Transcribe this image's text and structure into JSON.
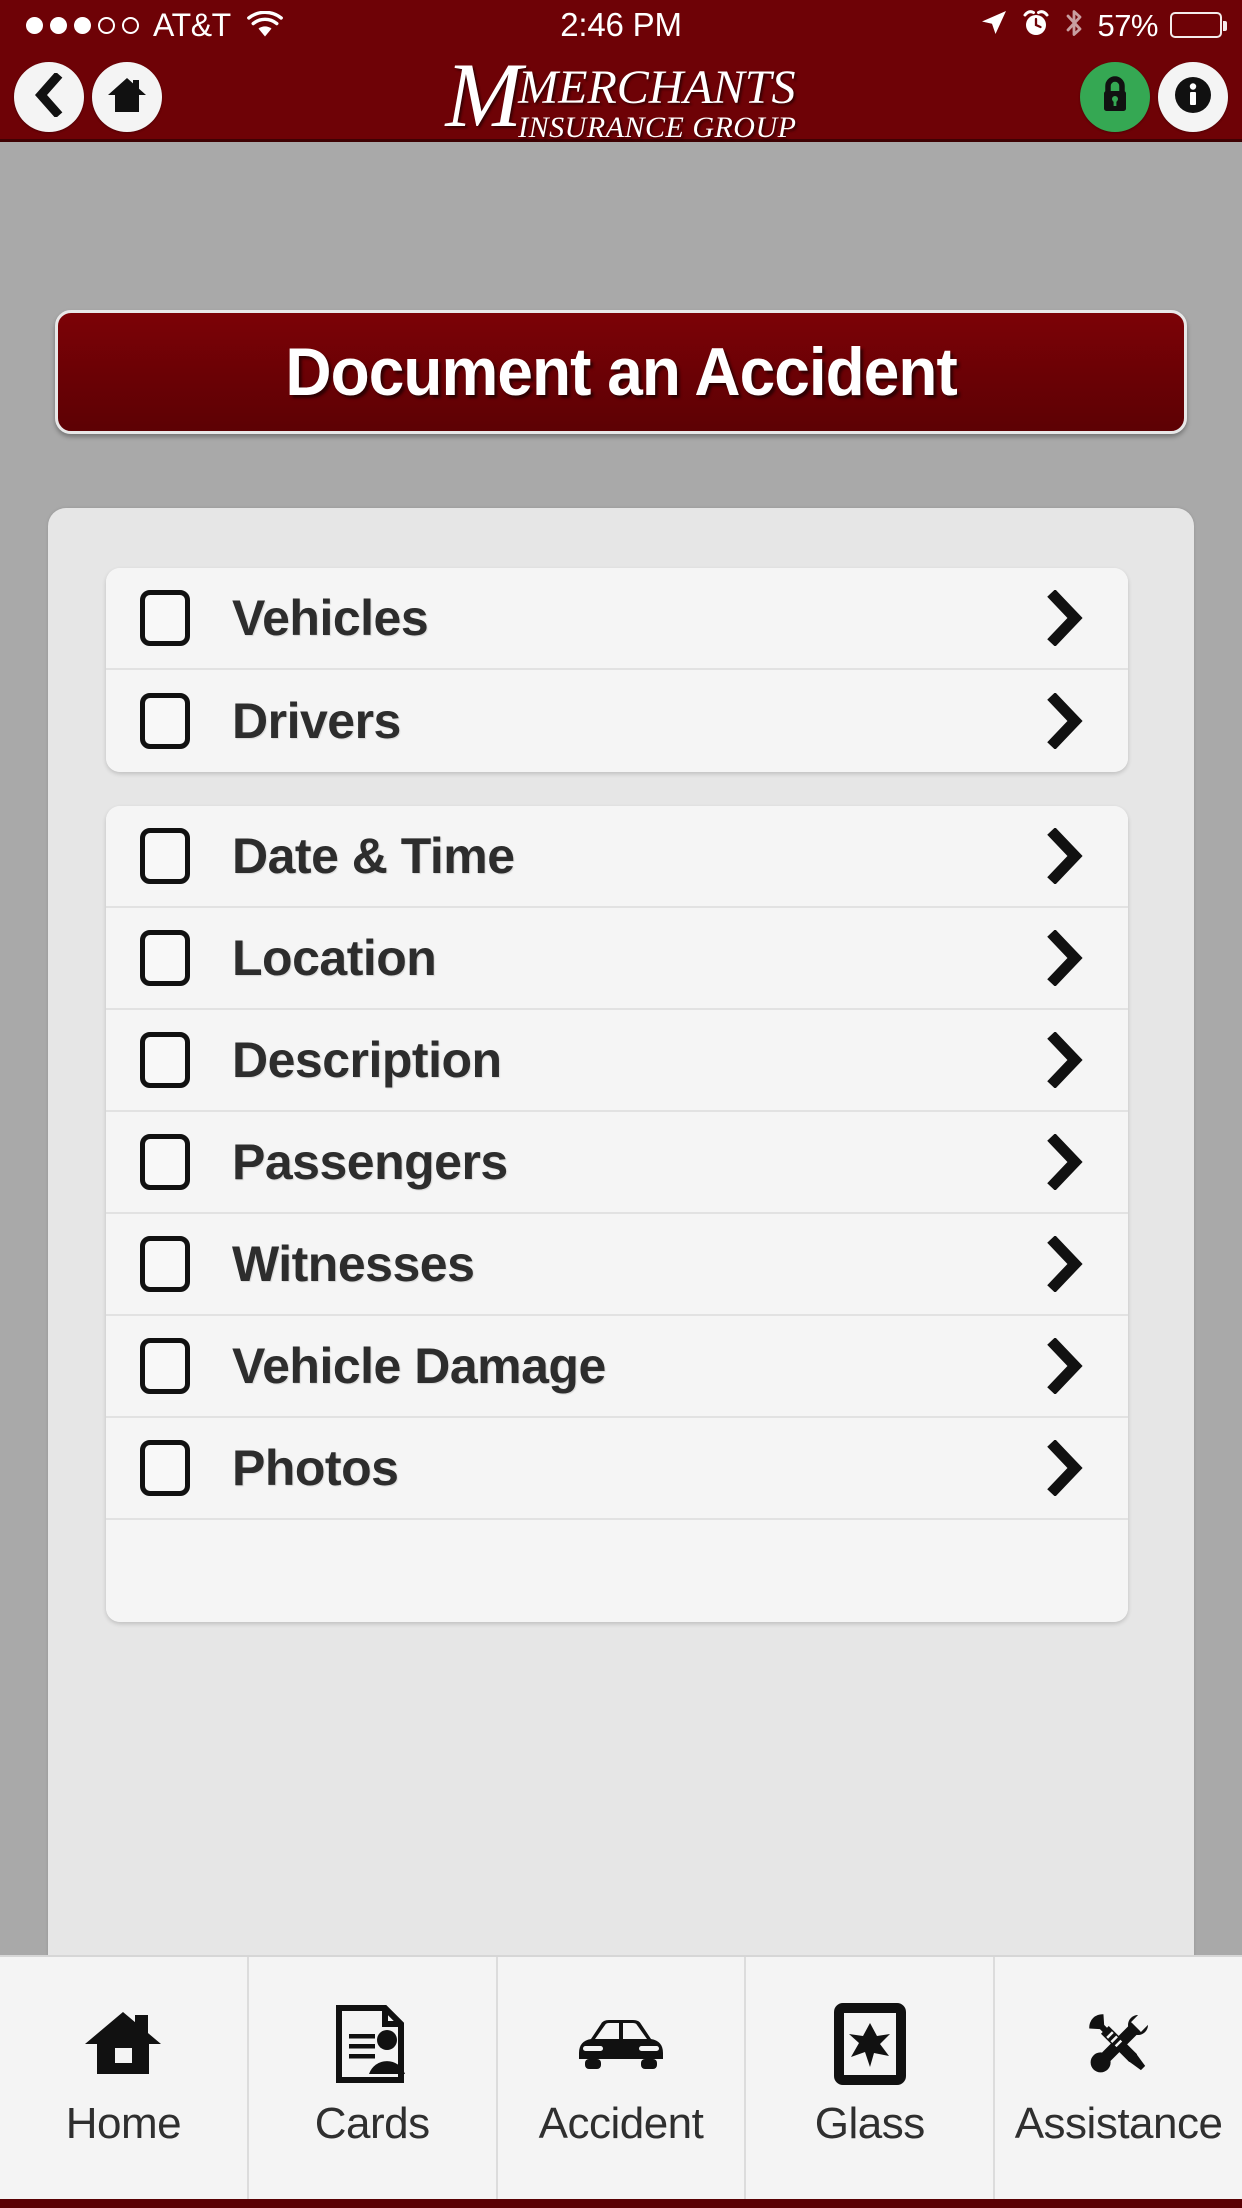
{
  "statusbar": {
    "carrier": "AT&T",
    "signal_dots_filled": 3,
    "signal_dots_total": 5,
    "wifi_icon": "wifi-icon",
    "time": "2:46 PM",
    "location_icon": "location-arrow-icon",
    "alarm_icon": "alarm-clock-icon",
    "bluetooth_icon": "bluetooth-icon",
    "battery_percent": "57%",
    "battery_level": 57
  },
  "navbar": {
    "back_icon": "chevron-left-icon",
    "home_icon": "home-icon",
    "lock_icon": "lock-icon",
    "info_icon": "info-icon",
    "logo": {
      "monogram": "M",
      "line1": "MERCHANTS",
      "line2": "INSURANCE GROUP"
    }
  },
  "main": {
    "title": "Document an Accident",
    "groups": [
      {
        "rows": [
          {
            "label": "Vehicles",
            "checked": false,
            "chevron": "chevron-right-icon"
          },
          {
            "label": "Drivers",
            "checked": false,
            "chevron": "chevron-right-icon"
          }
        ]
      },
      {
        "rows": [
          {
            "label": "Date & Time",
            "checked": false,
            "chevron": "chevron-right-icon"
          },
          {
            "label": "Location",
            "checked": false,
            "chevron": "chevron-right-icon"
          },
          {
            "label": "Description",
            "checked": false,
            "chevron": "chevron-right-icon"
          },
          {
            "label": "Passengers",
            "checked": false,
            "chevron": "chevron-right-icon"
          },
          {
            "label": "Witnesses",
            "checked": false,
            "chevron": "chevron-right-icon"
          },
          {
            "label": "Vehicle Damage",
            "checked": false,
            "chevron": "chevron-right-icon"
          },
          {
            "label": "Photos",
            "checked": false,
            "chevron": "chevron-right-icon"
          },
          {
            "label": "",
            "checked": false,
            "chevron": ""
          }
        ]
      }
    ]
  },
  "tabbar": {
    "tabs": [
      {
        "label": "Home",
        "icon": "home-icon"
      },
      {
        "label": "Cards",
        "icon": "id-card-document-icon"
      },
      {
        "label": "Accident",
        "icon": "car-icon"
      },
      {
        "label": "Glass",
        "icon": "cracked-glass-icon"
      },
      {
        "label": "Assistance",
        "icon": "wrench-screwdriver-icon"
      }
    ]
  },
  "colors": {
    "brand_maroon": "#6e0206",
    "brand_maroon_dark": "#3f0103",
    "page_background": "#a9a9a9",
    "panel_background": "#e6e6e6",
    "card_background": "#f5f5f5",
    "lock_green": "#35a853",
    "text_dark": "#2d2d2d"
  }
}
